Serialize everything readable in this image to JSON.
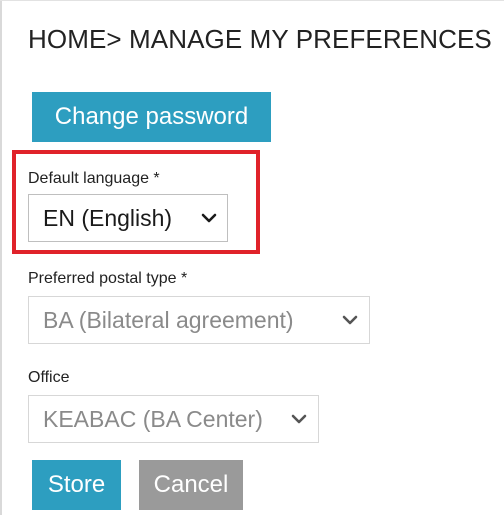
{
  "breadcrumb": {
    "home": "HOME",
    "separator": ">",
    "current": "MANAGE MY PREFERENCES"
  },
  "buttons": {
    "change_password": "Change password",
    "store": "Store",
    "cancel": "Cancel"
  },
  "form": {
    "default_language": {
      "label": "Default language *",
      "value": "EN (English)"
    },
    "preferred_postal_type": {
      "label": "Preferred postal type *",
      "value": "BA (Bilateral agreement)"
    },
    "office": {
      "label": "Office",
      "value": "KEABAC (BA Center)"
    }
  },
  "colors": {
    "primary_button": "#2d9ec0",
    "secondary_button": "#9a9a9a",
    "highlight": "#e0222a"
  },
  "icons": {
    "select_arrow": "chevron-down-icon"
  }
}
